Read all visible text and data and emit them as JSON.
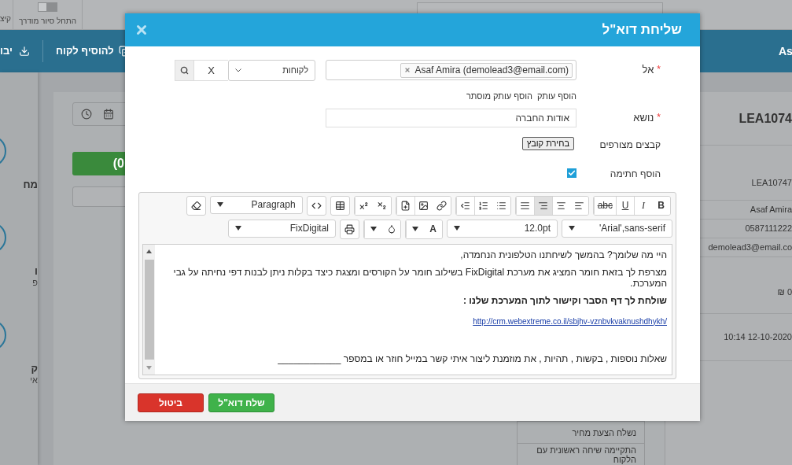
{
  "top_bar": {
    "cut_label": "קיצ",
    "tour_toggle": {
      "label": "התחל סיור מודרך",
      "on": false
    },
    "search": {
      "kind": "field"
    }
  },
  "header_band": {
    "import_label": "יבו",
    "add_customer": "להוסיף לקוח",
    "name_cut": "As"
  },
  "sidebar": {
    "items": [
      {
        "lines": [
          "מח"
        ]
      },
      {
        "lines": [
          "ו",
          "פ"
        ]
      },
      {
        "lines": [
          "ק",
          "אי"
        ]
      }
    ]
  },
  "record": {
    "green_button": "(0",
    "details": [
      {
        "kind": "title",
        "text": "LEA1074"
      },
      {
        "kind": "row",
        "text": "LEA10747"
      },
      {
        "kind": "row",
        "text": "Asaf Amira"
      },
      {
        "kind": "row",
        "text": "0587111222"
      },
      {
        "kind": "row",
        "text": "demolead3@email.co"
      },
      {
        "kind": "row",
        "text": "₪ 0"
      },
      {
        "kind": "row",
        "text": "10:14 12-10-2020"
      }
    ],
    "activity_list": [
      "נשלח הצעת מחיר",
      "התקיימה שיחה ראשונית עם הלקוח"
    ]
  },
  "dialog": {
    "title": "שליחת דוא\"ל",
    "to": {
      "label": "אל",
      "required_mark": "*",
      "recipients": [
        {
          "text": "Asaf Amira (demolead3@email.com)"
        }
      ],
      "source_select": "לקוחות",
      "clear_button": "X"
    },
    "cc_links": [
      "הוסף עותק",
      "הוסף עותק מוסתר"
    ],
    "subject": {
      "label": "נושא",
      "required_mark": "*",
      "value": "אודות החברה"
    },
    "attachments": {
      "label": "קבצים מצורפים",
      "button": "בחירת קובץ"
    },
    "signature": {
      "label": "הוסף חתימה",
      "checked": true
    },
    "editor": {
      "format_buttons": [
        "B",
        "I",
        "U",
        "abc"
      ],
      "align_buttons": [
        {
          "selected": false
        },
        {
          "selected": false
        },
        {
          "selected": true
        },
        {
          "selected": false
        }
      ],
      "block_select": "Paragraph",
      "font_select": "Arial',sans-serif'",
      "size_select": "12.0pt",
      "text_color_label": "A",
      "style_select": "FixDigital",
      "content": [
        {
          "kind": "text",
          "text": "היי מה שלומך? בהמשך לשיחתנו הטלפונית הנחמדה,"
        },
        {
          "kind": "text",
          "text": "מצרפת לך בזאת חומר המציג את מערכת  FixDigital בשילוב חומר על הקורסים ומצגת כיצד בקלות ניתן לבנות דפי נחיתה על גבי המערכת."
        },
        {
          "kind": "bold",
          "text": "שולחת לך דף הסבר וקישור לתוך המערכת שלנו :"
        },
        {
          "kind": "link",
          "text": "http://crm.webextreme.co.il/sbjhv-vznbvkvaknushdhykh/"
        },
        {
          "kind": "closing",
          "text": "שאלות נוספות , בקשות , תהיות , את מוזמנת ליצור איתי קשר במייל חוזר או במספר ____________"
        }
      ]
    },
    "buttons": [
      {
        "kind": "send",
        "label": "שלח דוא\"ל"
      },
      {
        "kind": "cancel",
        "label": "ביטול"
      }
    ]
  }
}
